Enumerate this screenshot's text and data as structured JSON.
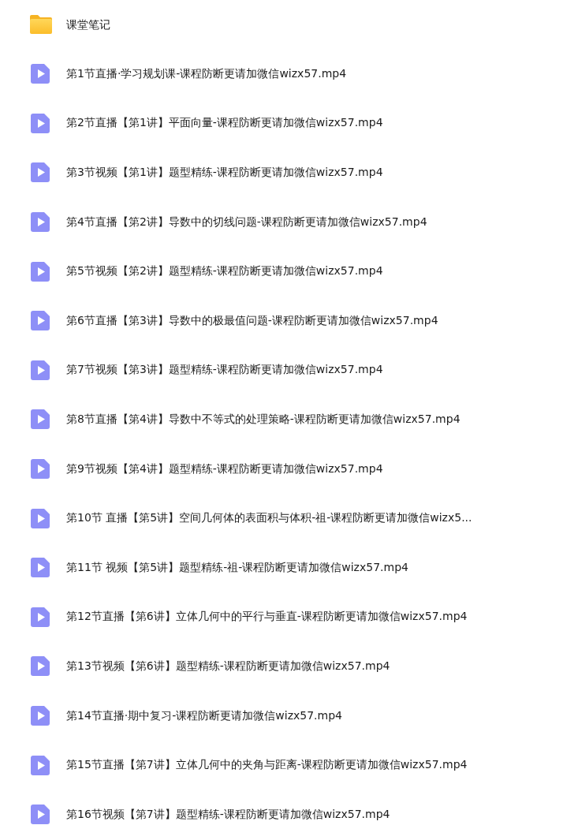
{
  "files": [
    {
      "kind": "folder",
      "name": "课堂笔记"
    },
    {
      "kind": "video",
      "name": "第1节直播·学习规划课-课程防断更请加微信wizx57.mp4"
    },
    {
      "kind": "video",
      "name": "第2节直播【第1讲】平面向量-课程防断更请加微信wizx57.mp4"
    },
    {
      "kind": "video",
      "name": "第3节视频【第1讲】题型精练-课程防断更请加微信wizx57.mp4"
    },
    {
      "kind": "video",
      "name": "第4节直播【第2讲】导数中的切线问题-课程防断更请加微信wizx57.mp4"
    },
    {
      "kind": "video",
      "name": "第5节视频【第2讲】题型精练-课程防断更请加微信wizx57.mp4"
    },
    {
      "kind": "video",
      "name": "第6节直播【第3讲】导数中的极最值问题-课程防断更请加微信wizx57.mp4"
    },
    {
      "kind": "video",
      "name": "第7节视频【第3讲】题型精练-课程防断更请加微信wizx57.mp4"
    },
    {
      "kind": "video",
      "name": "第8节直播【第4讲】导数中不等式的处理策略-课程防断更请加微信wizx57.mp4"
    },
    {
      "kind": "video",
      "name": "第9节视频【第4讲】题型精练-课程防断更请加微信wizx57.mp4"
    },
    {
      "kind": "video",
      "name": "第10节 直播【第5讲】空间几何体的表面积与体积-祖-课程防断更请加微信wizx5..."
    },
    {
      "kind": "video",
      "name": "第11节 视频【第5讲】题型精练-祖-课程防断更请加微信wizx57.mp4"
    },
    {
      "kind": "video",
      "name": "第12节直播【第6讲】立体几何中的平行与垂直-课程防断更请加微信wizx57.mp4"
    },
    {
      "kind": "video",
      "name": "第13节视频【第6讲】题型精练-课程防断更请加微信wizx57.mp4"
    },
    {
      "kind": "video",
      "name": "第14节直播·期中复习-课程防断更请加微信wizx57.mp4"
    },
    {
      "kind": "video",
      "name": "第15节直播【第7讲】立体几何中的夹角与距离-课程防断更请加微信wizx57.mp4"
    },
    {
      "kind": "video",
      "name": "第16节视频【第7讲】题型精练-课程防断更请加微信wizx57.mp4"
    }
  ]
}
